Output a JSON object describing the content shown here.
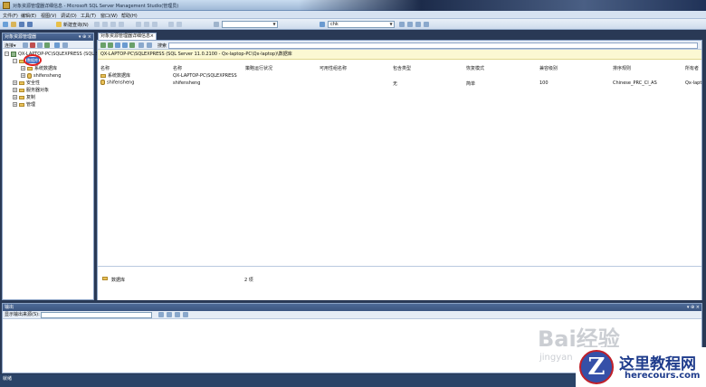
{
  "window": {
    "title": "对象资源管理器详细信息 - Microsoft SQL Server Management Studio(管理员)"
  },
  "menu": [
    "文件(F)",
    "编辑(E)",
    "视图(V)",
    "调试(D)",
    "工具(T)",
    "窗口(W)",
    "帮助(H)"
  ],
  "toolbar": {
    "new_query": "新建查询(N)",
    "db_combo": "",
    "db_combo2": "chk"
  },
  "object_explorer": {
    "title": "对象资源管理器",
    "connect_label": "连接▾",
    "server": "QX-LAPTOP-PC\\SQLEXPRESS (SQL S",
    "selected_node": "数据库",
    "nodes": [
      "系统数据库",
      "shifensheng",
      "安全性",
      "服务器对象",
      "复制",
      "管理"
    ]
  },
  "details": {
    "tab_title": "对象资源管理器详细信息",
    "search_label": "搜索",
    "path": "QX-LAPTOP-PC\\SQLEXPRESS (SQL Server 11.0.2100 - Qx-laptop-PC\\Qx-laptop)\\数据库",
    "columns": [
      "名称",
      "名称",
      "策略运行状况",
      "可用性组名称",
      "包含类型",
      "恢复模式",
      "兼容级别",
      "排序规则",
      "所有者"
    ],
    "rows": [
      {
        "name": "系统数据库",
        "server": "QX-LAPTOP-PC\\SQLEXPRESS",
        "policy": "",
        "ag": "",
        "containment": "",
        "recovery": "",
        "compat": "",
        "collation": "",
        "owner": ""
      },
      {
        "name": "shifensheng",
        "server": "shifensheng",
        "policy": "",
        "ag": "",
        "containment": "无",
        "recovery": "简单",
        "compat": "100",
        "collation": "Chinese_PRC_CI_AS",
        "owner": "Qx-lapt"
      }
    ],
    "status_label": "数据库",
    "status_count": "2 项"
  },
  "output": {
    "title": "输出",
    "source_label": "显示输出来源(S):"
  },
  "statusbar": {
    "text": "就绪"
  },
  "watermark": {
    "baidu": "Bai经验",
    "baidu2": "jingyan",
    "logo_cn": "这里教程网",
    "logo_en": "herecours.com",
    "logo_letter": "Z"
  }
}
